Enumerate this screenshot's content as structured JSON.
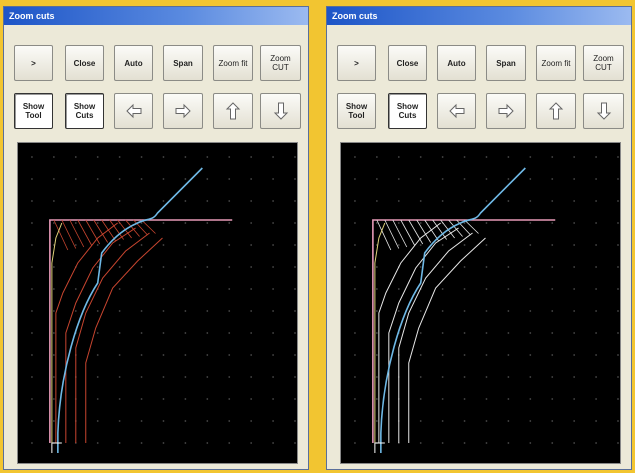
{
  "windows": [
    {
      "title": "Zoom cuts",
      "row1": [
        ">",
        "Close",
        "Auto",
        "Span",
        "Zoom fit",
        "Zoom\nCUT"
      ],
      "row2": [
        {
          "label": "Show\nTool",
          "pressed": true
        },
        {
          "label": "Show\nCuts",
          "pressed": true
        }
      ],
      "arrows": [
        "left-arrow-icon",
        "right-arrow-icon",
        "up-arrow-icon",
        "down-arrow-icon"
      ],
      "cut_color": "#c8452f",
      "guide_color": "#e0d27a"
    },
    {
      "title": "Zoom cuts",
      "row1": [
        ">",
        "Close",
        "Auto",
        "Span",
        "Zoom fit",
        "Zoom\nCUT"
      ],
      "row2": [
        {
          "label": "Show\nTool",
          "pressed": false
        },
        {
          "label": "Show\nCuts",
          "pressed": true
        }
      ],
      "arrows": [
        "left-arrow-icon",
        "right-arrow-icon",
        "up-arrow-icon",
        "down-arrow-icon"
      ],
      "cut_color": "#e8e8e8",
      "guide_color": "#e0d27a"
    }
  ],
  "colors": {
    "background": "#f2c531",
    "canvas": "#000000",
    "profile": "#6fb9e6",
    "stock": "#e79ab8",
    "grid_dot": "#4a4a4a"
  }
}
